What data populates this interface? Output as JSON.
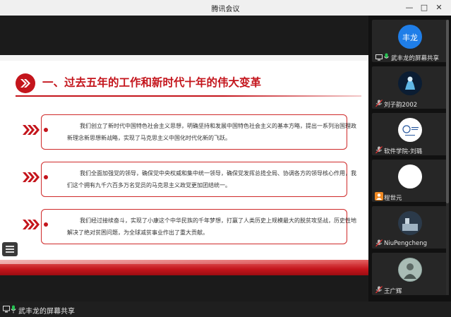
{
  "window": {
    "title": "腾讯会议"
  },
  "slide": {
    "heading": "一、过去五年的工作和新时代十年的伟大变革",
    "items": [
      {
        "text": "我们创立了新时代中国特色社会主义思想，明确坚持和发展中国特色社会主义的基本方略，提出一系列治国理政新理念新思想新战略，实现了马克思主义中国化时代化新的飞跃。"
      },
      {
        "text": "我们全面加强党的领导，确保党中央权威和集中统一领导，确保党发挥总揽全局、协调各方的领导核心作用，我们这个拥有九千六百多万名党员的马克思主义政党更加团结统一。"
      },
      {
        "text": "我们经过接续奋斗，实现了小康这个中华民族的千年梦想，打赢了人类历史上规模最大的脱贫攻坚战，历史性地解决了绝对贫困问题，为全球减贫事业作出了重大贡献。"
      }
    ],
    "accent_color": "#c4151c"
  },
  "share_status": {
    "label": "武丰龙的屏幕共享"
  },
  "participants": [
    {
      "name": "武丰龙的屏幕共享",
      "avatar_text": "丰龙",
      "avatar_color": "#1f7ee8",
      "icon": "screen-share-icon"
    },
    {
      "name": "刘子韵2002",
      "avatar_text": "",
      "avatar_color": "#0b1d33",
      "icon": "mic-off-icon"
    },
    {
      "name": "软件学院-刘璐",
      "avatar_text": "",
      "avatar_color": "#ffffff",
      "icon": "mic-off-icon"
    },
    {
      "name": "程世元",
      "avatar_text": "",
      "avatar_color": "#ffffff",
      "icon": "mic-off-icon"
    },
    {
      "name": "NiuPengcheng",
      "avatar_text": "",
      "avatar_color": "#2b3a4a",
      "icon": "mic-off-icon"
    },
    {
      "name": "王广辉",
      "avatar_text": "",
      "avatar_color": "#8fa6a0",
      "icon": "mic-off-icon"
    }
  ]
}
